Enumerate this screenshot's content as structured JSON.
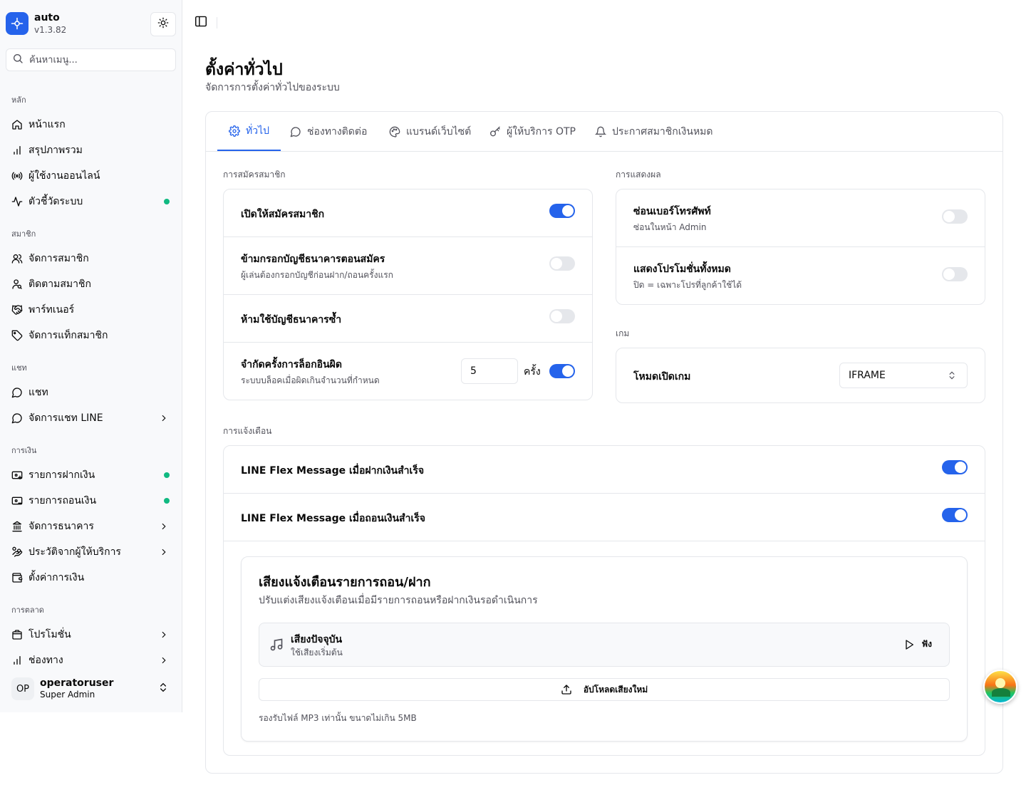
{
  "brand": {
    "name": "auto",
    "version": "v1.3.82"
  },
  "search": {
    "placeholder": "ค้นหาเมนู..."
  },
  "nav": {
    "groups": [
      {
        "label": "หลัก",
        "items": [
          {
            "label": "หน้าแรก",
            "icon": "home-icon"
          },
          {
            "label": "สรุปภาพรวม",
            "icon": "bar-chart-icon"
          },
          {
            "label": "ผู้ใช้งานออนไลน์",
            "icon": "radio-icon"
          },
          {
            "label": "ตัวชี้วัดระบบ",
            "icon": "activity-icon",
            "status": "online"
          }
        ]
      },
      {
        "label": "สมาชิก",
        "items": [
          {
            "label": "จัดการสมาชิก",
            "icon": "users-icon"
          },
          {
            "label": "ติดตามสมาชิก",
            "icon": "user-search-icon"
          },
          {
            "label": "พาร์ทเนอร์",
            "icon": "handshake-icon"
          },
          {
            "label": "จัดการแท็กสมาชิก",
            "icon": "tag-icon"
          }
        ]
      },
      {
        "label": "แชท",
        "items": [
          {
            "label": "แชท",
            "icon": "message-circle-icon"
          },
          {
            "label": "จัดการแชท LINE",
            "icon": "message-circle-icon",
            "expandable": true
          }
        ]
      },
      {
        "label": "การเงิน",
        "items": [
          {
            "label": "รายการฝากเงิน",
            "icon": "deposit-icon",
            "status": "online"
          },
          {
            "label": "รายการถอนเงิน",
            "icon": "withdraw-icon",
            "status": "online"
          },
          {
            "label": "จัดการธนาคาร",
            "icon": "bank-icon",
            "expandable": true
          },
          {
            "label": "ประวัติจากผู้ให้บริการ",
            "icon": "hand-coins-icon",
            "expandable": true
          },
          {
            "label": "ตั้งค่าการเงิน",
            "icon": "wallet-icon"
          }
        ]
      },
      {
        "label": "การตลาด",
        "items": [
          {
            "label": "โปรโมชั่น",
            "icon": "wallet-cards-icon",
            "expandable": true
          },
          {
            "label": "ช่องทาง",
            "icon": "bar-chart-icon",
            "expandable": true
          }
        ]
      }
    ]
  },
  "user": {
    "initials": "OP",
    "name": "operatoruser",
    "role": "Super Admin"
  },
  "page": {
    "title": "ตั้งค่าทั่วไป",
    "subtitle": "จัดการการตั้งค่าทั่วไปของระบบ"
  },
  "tabs": [
    {
      "label": "ทั่วไป",
      "icon": "gear-icon",
      "active": true
    },
    {
      "label": "ช่องทางติดต่อ",
      "icon": "message-circle-icon"
    },
    {
      "label": "แบรนด์เว็บไซต์",
      "icon": "palette-icon"
    },
    {
      "label": "ผู้ให้บริการ OTP",
      "icon": "key-icon"
    },
    {
      "label": "ประกาศสมาชิกเงินหมด",
      "icon": "bell-icon"
    }
  ],
  "registration": {
    "label": "การสมัครสมาชิก",
    "open": {
      "title": "เปิดให้สมัครสมาชิก",
      "on": true
    },
    "skip_bank": {
      "title": "ข้ามกรอกบัญชีธนาคารตอนสมัคร",
      "sub": "ผู้เล่นต้องกรอกบัญชีก่อนฝาก/ถอนครั้งแรก",
      "on": false
    },
    "no_dup_bank": {
      "title": "ห้ามใช้บัญชีธนาคารซ้ำ",
      "on": false
    },
    "login_limit": {
      "title": "จำกัดครั้งการล็อกอินผิด",
      "sub": "ระบบบล็อคเมื่อผิดเกินจำนวนที่กำหนด",
      "value": "5",
      "unit": "ครั้ง",
      "on": true
    }
  },
  "display": {
    "label": "การแสดงผล",
    "hide_phone": {
      "title": "ซ่อนเบอร์โทรศัพท์",
      "sub": "ซ่อนในหน้า Admin",
      "on": false
    },
    "show_promos": {
      "title": "แสดงโปรโมชั่นทั้งหมด",
      "sub": "ปิด = เฉพาะโปรที่ลูกค้าใช้ได้",
      "on": false
    }
  },
  "game": {
    "label": "เกม",
    "mode": {
      "title": "โหมดเปิดเกม",
      "value": "IFRAME"
    }
  },
  "notifications": {
    "label": "การแจ้งเตือน",
    "deposit_flex": {
      "title": "LINE Flex Message เมื่อฝากเงินสำเร็จ",
      "on": true
    },
    "withdraw_flex": {
      "title": "LINE Flex Message เมื่อถอนเงินสำเร็จ",
      "on": true
    },
    "sound": {
      "title": "เสียงแจ้งเตือนรายการถอน/ฝาก",
      "subtitle": "ปรับแต่งเสียงแจ้งเตือนเมื่อมีรายการถอนหรือฝากเงินรอดำเนินการ",
      "current_title": "เสียงปัจจุบัน",
      "current_sub": "ใช้เสียงเริ่มต้น",
      "listen_label": "ฟัง",
      "upload_label": "อัปโหลดเสียงใหม่",
      "note": "รองรับไฟล์ MP3 เท่านั้น ขนาดไม่เกิน 5MB"
    }
  },
  "colors": {
    "accent": "#2563eb",
    "online": "#10b981",
    "border": "#e5e7eb",
    "muted": "#52525b"
  }
}
